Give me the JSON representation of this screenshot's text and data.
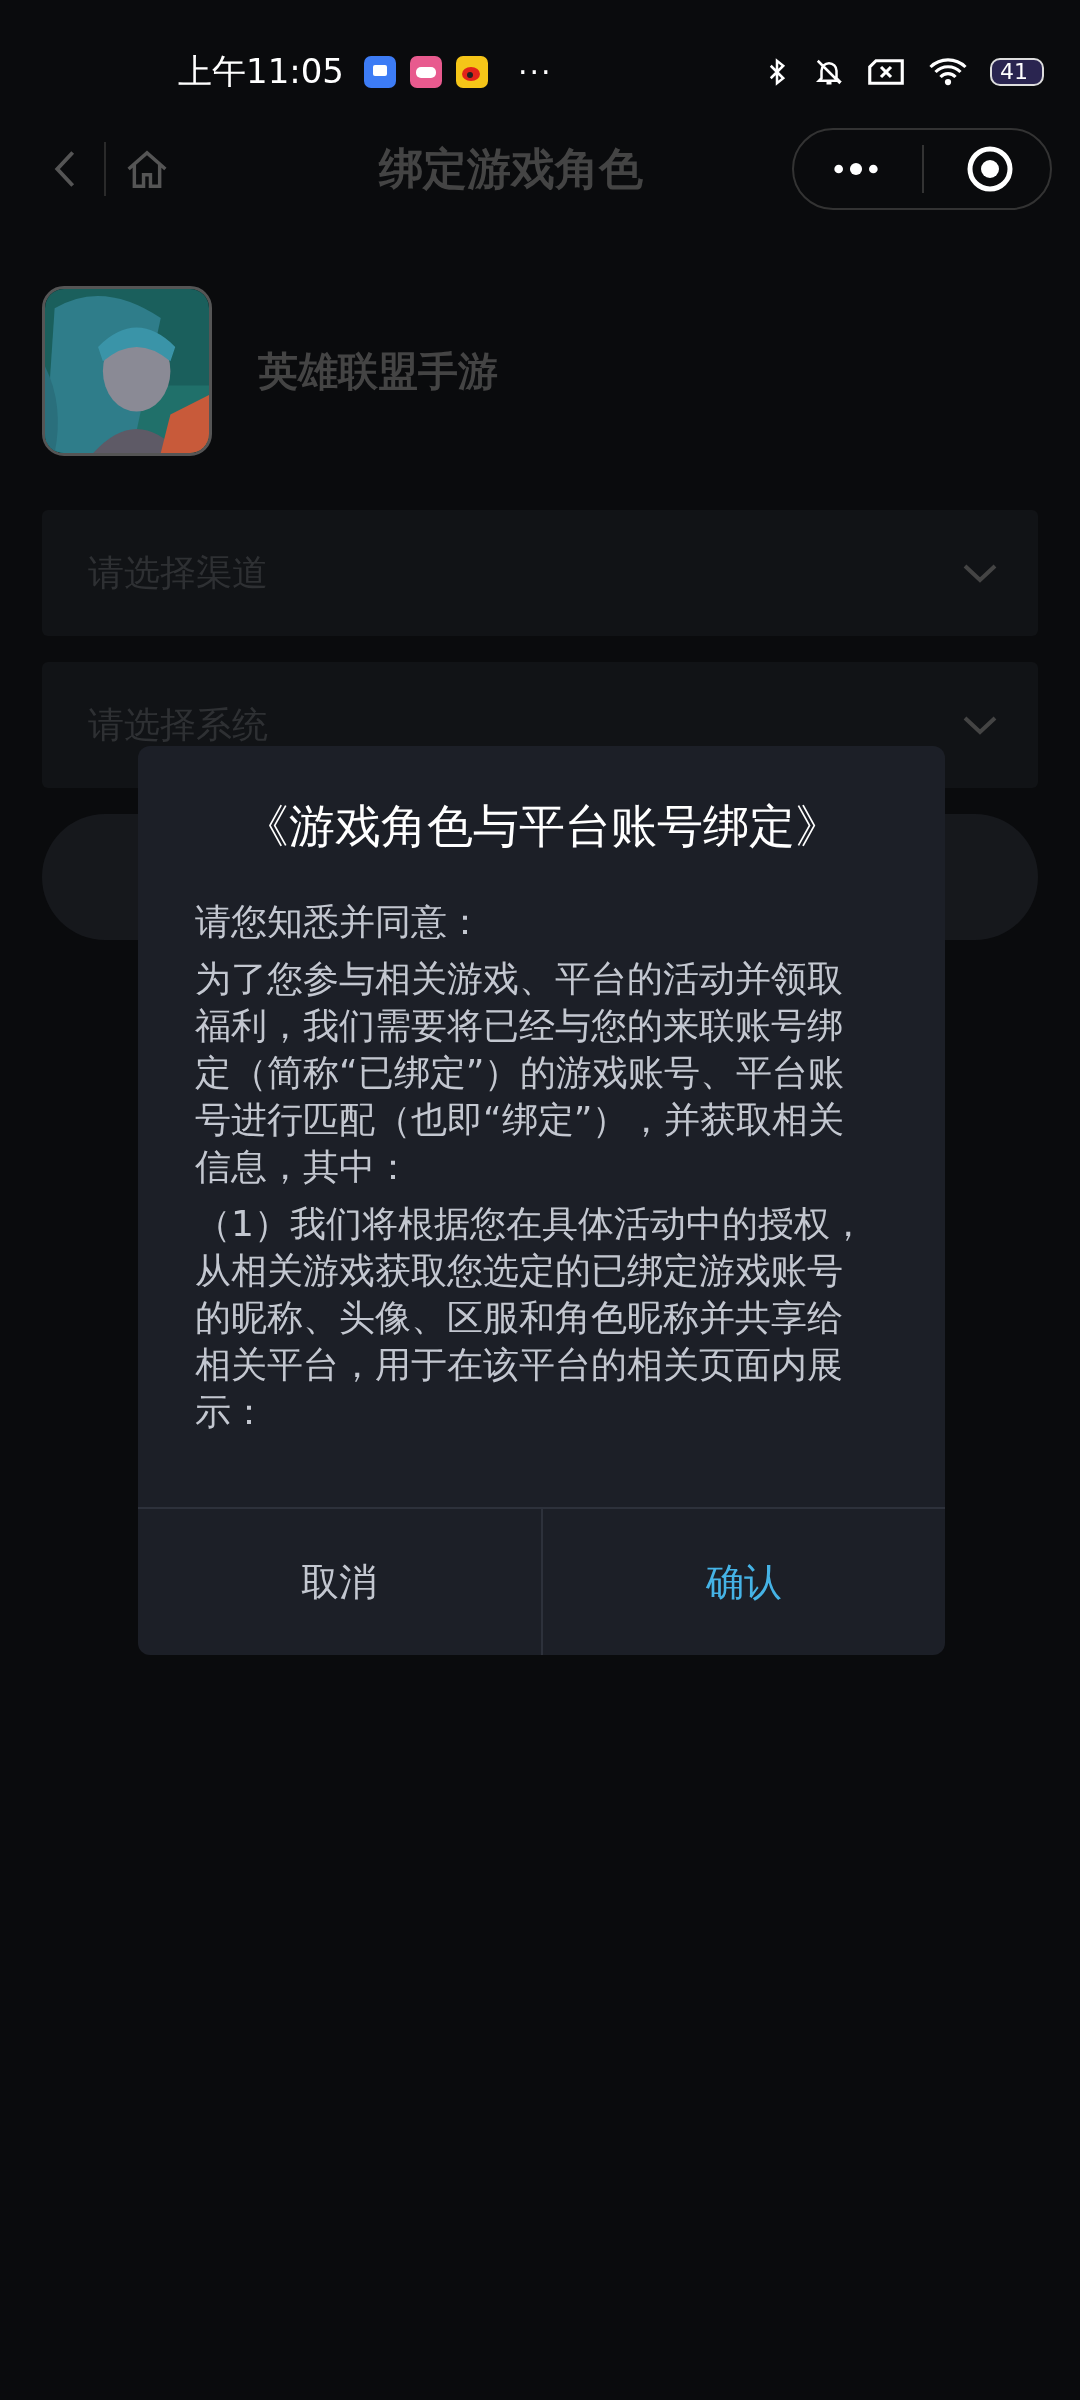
{
  "status_bar": {
    "time": "上午11:05",
    "more": "···",
    "battery": "41"
  },
  "nav_bar": {
    "title": "绑定游戏角色"
  },
  "game": {
    "name": "英雄联盟手游"
  },
  "selects": [
    {
      "placeholder": "请选择渠道"
    },
    {
      "placeholder": "请选择系统"
    }
  ],
  "dialog": {
    "title": "《游戏角色与平台账号绑定》",
    "paragraphs": [
      "请您知悉并同意：",
      "为了您参与相关游戏、平台的活动并领取福利，我们需要将已经与您的来联账号绑定（简称“已绑定”）的游戏账号、平台账号进行匹配（也即“绑定”），并获取相关信息，其中：",
      "（1）我们将根据您在具体活动中的授权，从相关游戏获取您选定的已绑定游戏账号的昵称、头像、区服和角色昵称并共享给相关平台，用于在该平台的相关页面内展示："
    ],
    "buttons": [
      {
        "label": "取消",
        "kind": "cancel"
      },
      {
        "label": "确认",
        "kind": "confirm"
      }
    ]
  }
}
